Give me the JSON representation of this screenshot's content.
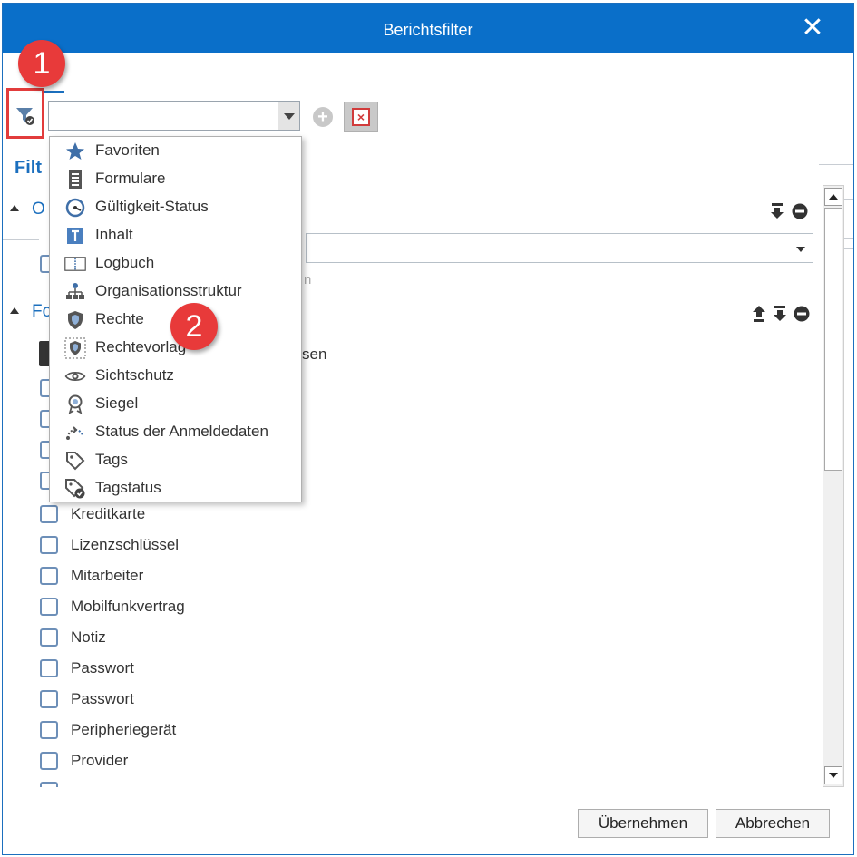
{
  "window": {
    "title": "Berichtsfilter"
  },
  "toolbar": {
    "combo_value": ""
  },
  "panel": {
    "filter_label": "Filt",
    "section1_label": "O",
    "section2_label": "Fo",
    "hint_text": "n",
    "partial_text": "sen"
  },
  "menu": {
    "items": [
      {
        "label": "Favoriten",
        "icon": "star-icon"
      },
      {
        "label": "Formulare",
        "icon": "form-icon"
      },
      {
        "label": "Gültigkeit-Status",
        "icon": "validity-status-icon"
      },
      {
        "label": "Inhalt",
        "icon": "content-icon"
      },
      {
        "label": "Logbuch",
        "icon": "logbook-icon"
      },
      {
        "label": "Organisationsstruktur",
        "icon": "org-structure-icon"
      },
      {
        "label": "Rechte",
        "icon": "shield-icon"
      },
      {
        "label": "Rechtevorlag",
        "icon": "shield-template-icon"
      },
      {
        "label": "Sichtschutz",
        "icon": "eye-icon"
      },
      {
        "label": "Siegel",
        "icon": "seal-icon"
      },
      {
        "label": "Status der Anmeldedaten",
        "icon": "credentials-status-icon"
      },
      {
        "label": "Tags",
        "icon": "tag-icon"
      },
      {
        "label": "Tagstatus",
        "icon": "tag-status-icon"
      }
    ]
  },
  "checkboxes": [
    {
      "label": "Kreditkarte",
      "checked": false
    },
    {
      "label": "Lizenzschlüssel",
      "checked": false
    },
    {
      "label": "Mitarbeiter",
      "checked": false
    },
    {
      "label": "Mobilfunkvertrag",
      "checked": false
    },
    {
      "label": "Notiz",
      "checked": false
    },
    {
      "label": "Passwort",
      "checked": false
    },
    {
      "label": "Passwort",
      "checked": false
    },
    {
      "label": "Peripheriegerät",
      "checked": false
    },
    {
      "label": "Provider",
      "checked": false
    }
  ],
  "badges": {
    "one": "1",
    "two": "2"
  },
  "footer": {
    "apply": "Übernehmen",
    "cancel": "Abbrechen"
  },
  "colors": {
    "titlebar": "#0a6fc9",
    "accent": "#1b6fbe",
    "badge": "#e83a3a"
  }
}
